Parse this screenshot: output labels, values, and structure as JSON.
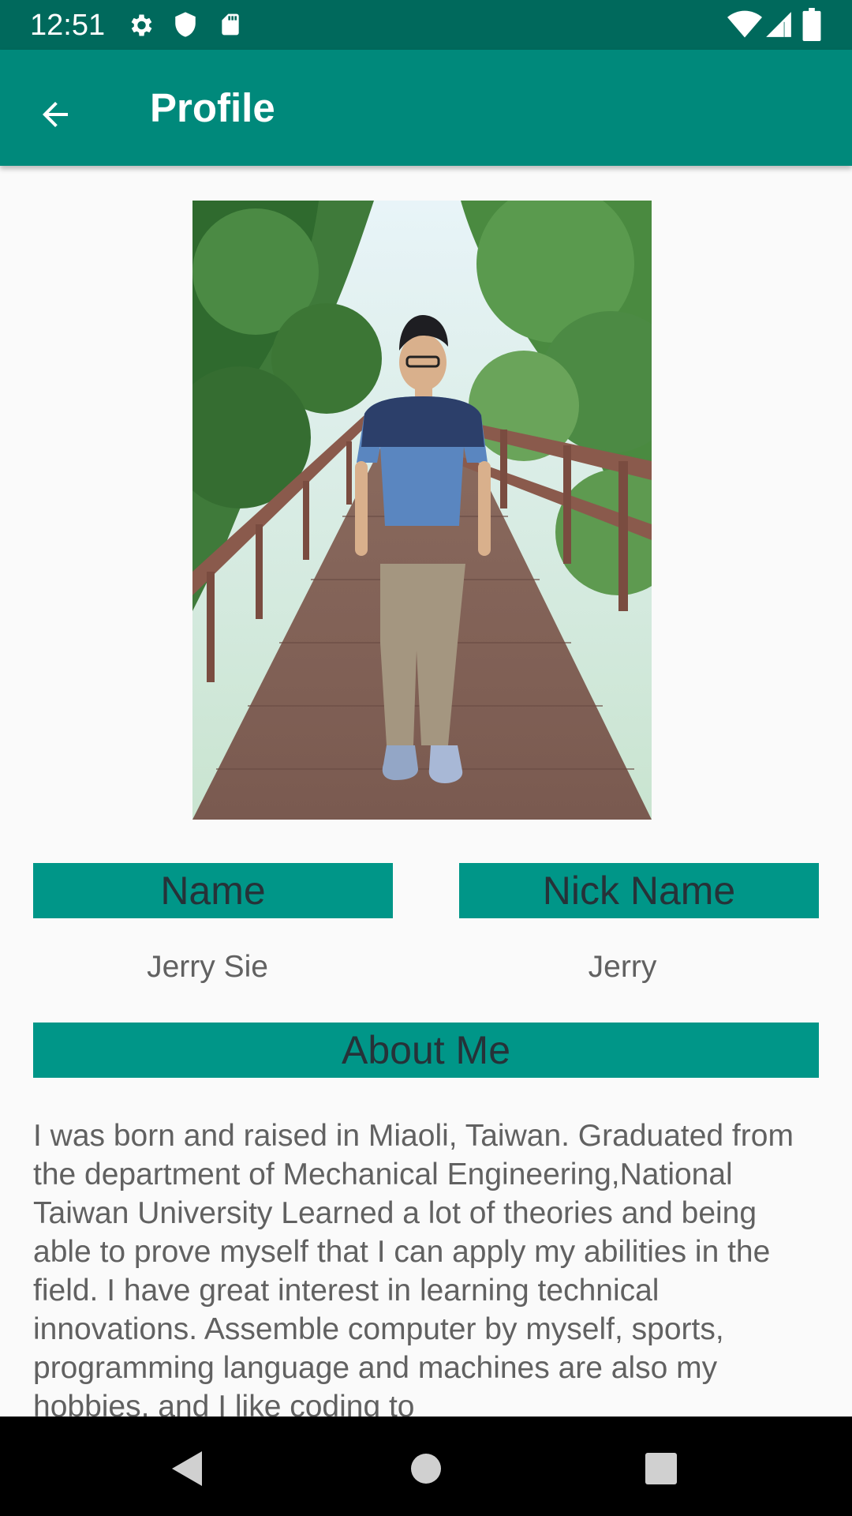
{
  "status_bar": {
    "time": "12:51",
    "left_icons": [
      "gear-icon",
      "shield-icon",
      "sd-card-icon"
    ],
    "right_icons": [
      "wifi-icon",
      "cell-signal-icon",
      "battery-icon"
    ],
    "color": "#00695c"
  },
  "app_bar": {
    "title": "Profile",
    "color": "#00897b"
  },
  "profile": {
    "photo": "person-standing-on-boardwalk-photo",
    "name_label": "Name",
    "name_value": "Jerry Sie",
    "nickname_label": "Nick Name",
    "nickname_value": "Jerry",
    "about_label": "About Me",
    "about_text": "I was born and raised in Miaoli, Taiwan. Graduated from the department of Mechanical Engineering,National Taiwan University Learned a lot of theories and being able to prove myself that I can apply my abilities in the field. I have great interest in learning technical innovations. Assemble computer by myself, sports, programming language and machines are also my hobbies, and I like coding to",
    "label_color": "#009688"
  },
  "nav_bar": {
    "buttons": [
      "back-triangle-icon",
      "home-circle-icon",
      "recents-square-icon"
    ]
  }
}
